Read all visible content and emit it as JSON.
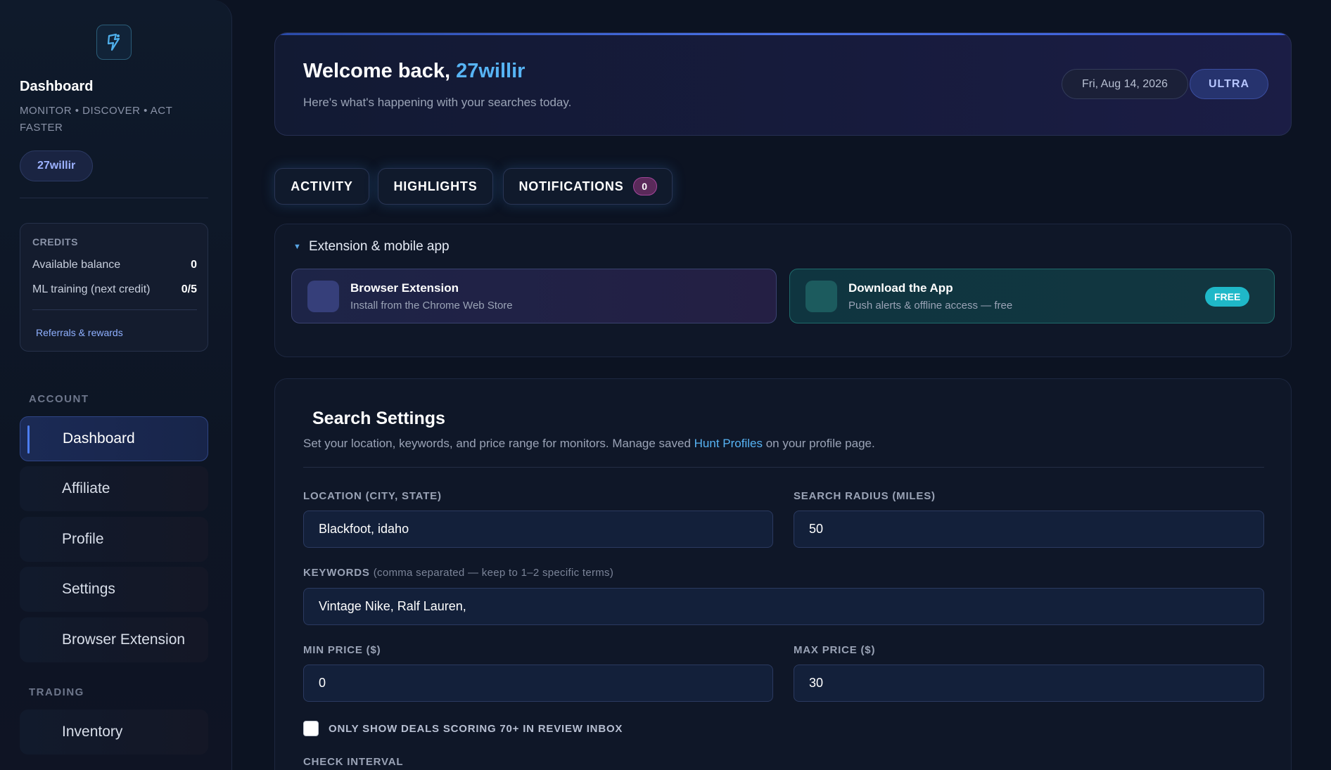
{
  "sidebar": {
    "title": "Dashboard",
    "tagline": "MONITOR • DISCOVER • ACT FASTER",
    "username": "27willir",
    "credits": {
      "label": "CREDITS",
      "balance_label": "Available balance",
      "balance_value": "0",
      "training_label": "ML training (next credit)",
      "training_value": "0/5",
      "referrals_link": "Referrals & rewards"
    },
    "sections": {
      "account": "ACCOUNT",
      "trading": "TRADING"
    },
    "nav": {
      "dashboard": "Dashboard",
      "affiliate": "Affiliate",
      "profile": "Profile",
      "settings": "Settings",
      "browser_extension": "Browser Extension",
      "inventory": "Inventory"
    }
  },
  "welcome": {
    "greeting": "Welcome back,",
    "username": "27willir",
    "subtitle": "Here's what's happening with your searches today.",
    "date": "Fri, Aug 14, 2026",
    "plan": "ULTRA"
  },
  "tabs": {
    "activity": "ACTIVITY",
    "highlights": "HIGHLIGHTS",
    "notifications": "NOTIFICATIONS",
    "notifications_count": "0"
  },
  "extensions": {
    "title": "Extension & mobile app",
    "browser": {
      "title": "Browser Extension",
      "subtitle": "Install from the Chrome Web Store"
    },
    "app": {
      "title": "Download the App",
      "subtitle": "Push alerts & offline access — free",
      "badge": "FREE"
    }
  },
  "search_settings": {
    "title": "Search Settings",
    "desc_prefix": "Set your location, keywords, and price range for monitors. Manage saved",
    "desc_link": "Hunt Profiles",
    "desc_suffix": "on your profile page.",
    "location_label": "LOCATION (CITY, STATE)",
    "location_value": "Blackfoot, idaho",
    "radius_label": "SEARCH RADIUS (MILES)",
    "radius_value": "50",
    "keywords_label": "KEYWORDS",
    "keywords_hint": "(comma separated — keep to 1–2 specific terms)",
    "keywords_value": "Vintage Nike, Ralf Lauren,",
    "min_price_label": "MIN PRICE ($)",
    "min_price_value": "0",
    "max_price_label": "MAX PRICE ($)",
    "max_price_value": "30",
    "review_checkbox_label": "ONLY SHOW DEALS SCORING 70+ IN REVIEW INBOX",
    "review_checkbox_checked": false,
    "check_interval_label": "CHECK INTERVAL"
  },
  "icons": {
    "logo": "app-logo-icon",
    "collapse": "caret-down-icon"
  },
  "colors": {
    "accent_blue": "#57b4f5",
    "ultra_badge": "#26336e",
    "free_badge": "#1fb8c8",
    "notification_badge": "#5a2a5a"
  }
}
